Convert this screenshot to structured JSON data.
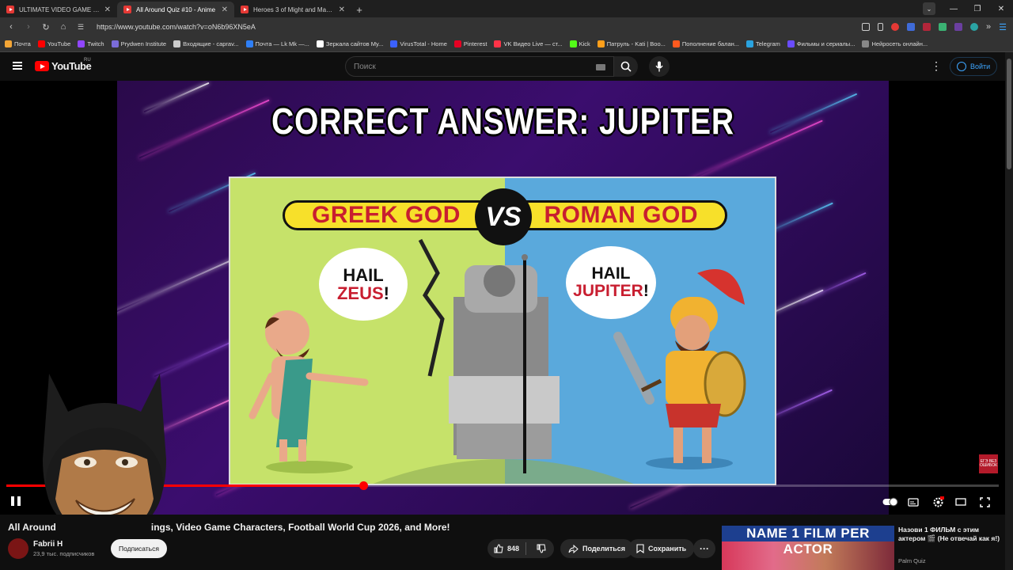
{
  "browser": {
    "tabs": [
      {
        "title": "ULTIMATE VIDEO GAME QUIZ #2",
        "active": false
      },
      {
        "title": "All Around Quiz #10 - Anime",
        "active": true
      },
      {
        "title": "Heroes 3 of Might and Magic So",
        "active": false
      }
    ],
    "url": "https://www.youtube.com/watch?v=oN6b96XN5eA",
    "bookmarks": [
      {
        "label": "Почта",
        "color": "#f4a636"
      },
      {
        "label": "YouTube",
        "color": "#ff0000"
      },
      {
        "label": "Twitch",
        "color": "#9146ff"
      },
      {
        "label": "Prydwen Institute",
        "color": "#7b6cd9"
      },
      {
        "label": "Входящие - caprav...",
        "color": "#cccccc"
      },
      {
        "label": "Почта — Lk Mk —...",
        "color": "#2f7ff5"
      },
      {
        "label": "Зеркала сайтов My...",
        "color": "#ffffff"
      },
      {
        "label": "VirusTotal - Home",
        "color": "#3b61ff"
      },
      {
        "label": "Pinterest",
        "color": "#e60023"
      },
      {
        "label": "VK Видео Live — ст...",
        "color": "#ff3347"
      },
      {
        "label": "Kick",
        "color": "#53fc18"
      },
      {
        "label": "Патруль - Kati | Boo...",
        "color": "#ff9f1a"
      },
      {
        "label": "Пополнение балан...",
        "color": "#ff5a1f"
      },
      {
        "label": "Telegram",
        "color": "#2aa3df"
      },
      {
        "label": "Фильмы и сериалы...",
        "color": "#6a4cff"
      },
      {
        "label": "Нейросеть онлайн...",
        "color": "#888888"
      }
    ]
  },
  "youtube": {
    "logo": "YouTube",
    "region": "RU",
    "search_placeholder": "Поиск",
    "login_label": "Войти"
  },
  "video": {
    "frame_title": "CORRECT ANSWER: JUPITER",
    "banner_left": "GREEK GOD",
    "banner_vs": "VS",
    "banner_right": "ROMAN GOD",
    "bubble_left_1": "HAIL",
    "bubble_left_2": "ZEUS",
    "bubble_left_excl": "!",
    "bubble_right_1": "HAIL",
    "bubble_right_2": "JUPITER",
    "bubble_right_excl": "!",
    "progress_fraction": 0.36,
    "endcard_text": "ЕГЭ ВЕЗ ОШИБОК"
  },
  "below": {
    "title_visible_start": "All Around",
    "title_visible_end": "ings, Video Game Characters, Football World Cup 2026, and More!",
    "channel_name": "Fabrii H",
    "subscribers": "23,9 тыс. подписчиков",
    "subscribe_label": "Подписаться",
    "likes": "848",
    "share_label": "Поделиться",
    "save_label": "Сохранить"
  },
  "suggestion": {
    "thumb_text": "NAME 1 FILM PER ACTOR",
    "title": "Назови 1 ФИЛЬМ с этим актером 🎬 (Не отвечай как я!)",
    "channel": "Palm Quiz"
  }
}
